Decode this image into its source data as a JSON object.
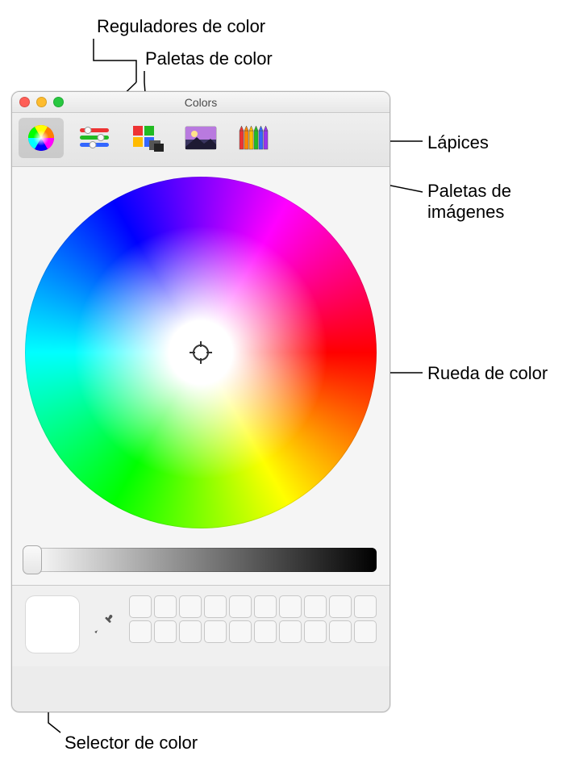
{
  "annotations": {
    "sliders": "Reguladores de color",
    "palettes": "Paletas de color",
    "pencils": "Lápices",
    "image_palettes": "Paletas de imágenes",
    "color_wheel": "Rueda de color",
    "color_picker": "Selector de color"
  },
  "window": {
    "title": "Colors",
    "traffic": {
      "close": "#ff5f57",
      "minimize": "#febc2e",
      "zoom": "#28c840"
    }
  },
  "toolbar": {
    "wheel": {
      "name": "color-wheel-tab",
      "active": true
    },
    "sliders": {
      "name": "color-sliders-tab",
      "active": false
    },
    "palettes": {
      "name": "color-palettes-tab",
      "active": false
    },
    "image": {
      "name": "image-palettes-tab",
      "active": false
    },
    "pencils": {
      "name": "pencils-tab",
      "active": false
    }
  },
  "brightness_slider": {
    "value": 1.0
  },
  "current_color": "#ffffff",
  "swatch_rows": 2,
  "swatch_cols": 10
}
